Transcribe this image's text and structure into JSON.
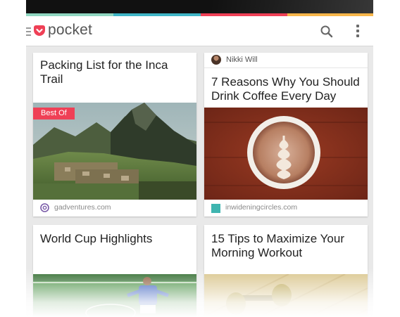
{
  "app": {
    "name": "pocket",
    "accent": "#ef4056",
    "stripe_colors": [
      "#8fd6c0",
      "#3fb5c6",
      "#ef4056",
      "#f7b64a"
    ]
  },
  "toolbar": {
    "menu_icon": "menu-icon",
    "search_icon": "search-icon",
    "more_icon": "more-vert-icon"
  },
  "cards": [
    {
      "title": "Packing List for the Inca Trail",
      "badge": "Best Of",
      "domain": "gadventures.com",
      "domain_icon": "at-sign-icon",
      "image": "mountain-ruins-photo"
    },
    {
      "author": "Nikki Will",
      "title": "7 Reasons Why You Should Drink Coffee Every Day",
      "domain": "inwideningcircles.com",
      "domain_icon": "teal-square-icon",
      "image": "latte-art-photo"
    },
    {
      "title": "World Cup Highlights",
      "image": "soccer-player-photo"
    },
    {
      "title": "15 Tips to Maximize Your Morning Workout",
      "image": "dumbbells-photo"
    }
  ]
}
